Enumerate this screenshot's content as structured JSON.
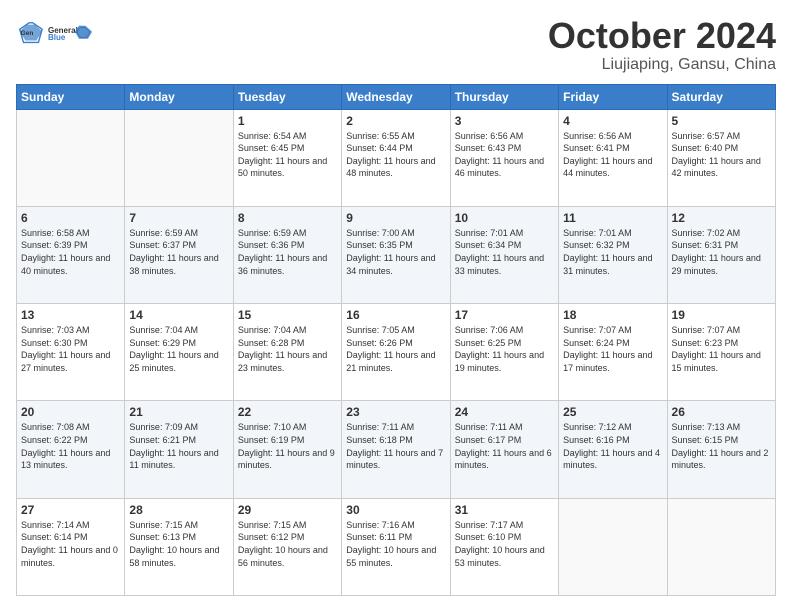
{
  "logo": {
    "line1": "General",
    "line2": "Blue"
  },
  "title": "October 2024",
  "subtitle": "Liujiaping, Gansu, China",
  "days_of_week": [
    "Sunday",
    "Monday",
    "Tuesday",
    "Wednesday",
    "Thursday",
    "Friday",
    "Saturday"
  ],
  "weeks": [
    [
      {
        "day": "",
        "empty": true
      },
      {
        "day": "",
        "empty": true
      },
      {
        "day": "1",
        "sunrise": "6:54 AM",
        "sunset": "6:45 PM",
        "daylight": "11 hours and 50 minutes."
      },
      {
        "day": "2",
        "sunrise": "6:55 AM",
        "sunset": "6:44 PM",
        "daylight": "11 hours and 48 minutes."
      },
      {
        "day": "3",
        "sunrise": "6:56 AM",
        "sunset": "6:43 PM",
        "daylight": "11 hours and 46 minutes."
      },
      {
        "day": "4",
        "sunrise": "6:56 AM",
        "sunset": "6:41 PM",
        "daylight": "11 hours and 44 minutes."
      },
      {
        "day": "5",
        "sunrise": "6:57 AM",
        "sunset": "6:40 PM",
        "daylight": "11 hours and 42 minutes."
      }
    ],
    [
      {
        "day": "6",
        "sunrise": "6:58 AM",
        "sunset": "6:39 PM",
        "daylight": "11 hours and 40 minutes."
      },
      {
        "day": "7",
        "sunrise": "6:59 AM",
        "sunset": "6:37 PM",
        "daylight": "11 hours and 38 minutes."
      },
      {
        "day": "8",
        "sunrise": "6:59 AM",
        "sunset": "6:36 PM",
        "daylight": "11 hours and 36 minutes."
      },
      {
        "day": "9",
        "sunrise": "7:00 AM",
        "sunset": "6:35 PM",
        "daylight": "11 hours and 34 minutes."
      },
      {
        "day": "10",
        "sunrise": "7:01 AM",
        "sunset": "6:34 PM",
        "daylight": "11 hours and 33 minutes."
      },
      {
        "day": "11",
        "sunrise": "7:01 AM",
        "sunset": "6:32 PM",
        "daylight": "11 hours and 31 minutes."
      },
      {
        "day": "12",
        "sunrise": "7:02 AM",
        "sunset": "6:31 PM",
        "daylight": "11 hours and 29 minutes."
      }
    ],
    [
      {
        "day": "13",
        "sunrise": "7:03 AM",
        "sunset": "6:30 PM",
        "daylight": "11 hours and 27 minutes."
      },
      {
        "day": "14",
        "sunrise": "7:04 AM",
        "sunset": "6:29 PM",
        "daylight": "11 hours and 25 minutes."
      },
      {
        "day": "15",
        "sunrise": "7:04 AM",
        "sunset": "6:28 PM",
        "daylight": "11 hours and 23 minutes."
      },
      {
        "day": "16",
        "sunrise": "7:05 AM",
        "sunset": "6:26 PM",
        "daylight": "11 hours and 21 minutes."
      },
      {
        "day": "17",
        "sunrise": "7:06 AM",
        "sunset": "6:25 PM",
        "daylight": "11 hours and 19 minutes."
      },
      {
        "day": "18",
        "sunrise": "7:07 AM",
        "sunset": "6:24 PM",
        "daylight": "11 hours and 17 minutes."
      },
      {
        "day": "19",
        "sunrise": "7:07 AM",
        "sunset": "6:23 PM",
        "daylight": "11 hours and 15 minutes."
      }
    ],
    [
      {
        "day": "20",
        "sunrise": "7:08 AM",
        "sunset": "6:22 PM",
        "daylight": "11 hours and 13 minutes."
      },
      {
        "day": "21",
        "sunrise": "7:09 AM",
        "sunset": "6:21 PM",
        "daylight": "11 hours and 11 minutes."
      },
      {
        "day": "22",
        "sunrise": "7:10 AM",
        "sunset": "6:19 PM",
        "daylight": "11 hours and 9 minutes."
      },
      {
        "day": "23",
        "sunrise": "7:11 AM",
        "sunset": "6:18 PM",
        "daylight": "11 hours and 7 minutes."
      },
      {
        "day": "24",
        "sunrise": "7:11 AM",
        "sunset": "6:17 PM",
        "daylight": "11 hours and 6 minutes."
      },
      {
        "day": "25",
        "sunrise": "7:12 AM",
        "sunset": "6:16 PM",
        "daylight": "11 hours and 4 minutes."
      },
      {
        "day": "26",
        "sunrise": "7:13 AM",
        "sunset": "6:15 PM",
        "daylight": "11 hours and 2 minutes."
      }
    ],
    [
      {
        "day": "27",
        "sunrise": "7:14 AM",
        "sunset": "6:14 PM",
        "daylight": "11 hours and 0 minutes."
      },
      {
        "day": "28",
        "sunrise": "7:15 AM",
        "sunset": "6:13 PM",
        "daylight": "10 hours and 58 minutes."
      },
      {
        "day": "29",
        "sunrise": "7:15 AM",
        "sunset": "6:12 PM",
        "daylight": "10 hours and 56 minutes."
      },
      {
        "day": "30",
        "sunrise": "7:16 AM",
        "sunset": "6:11 PM",
        "daylight": "10 hours and 55 minutes."
      },
      {
        "day": "31",
        "sunrise": "7:17 AM",
        "sunset": "6:10 PM",
        "daylight": "10 hours and 53 minutes."
      },
      {
        "day": "",
        "empty": true
      },
      {
        "day": "",
        "empty": true
      }
    ]
  ],
  "labels": {
    "sunrise": "Sunrise:",
    "sunset": "Sunset:",
    "daylight": "Daylight:"
  }
}
